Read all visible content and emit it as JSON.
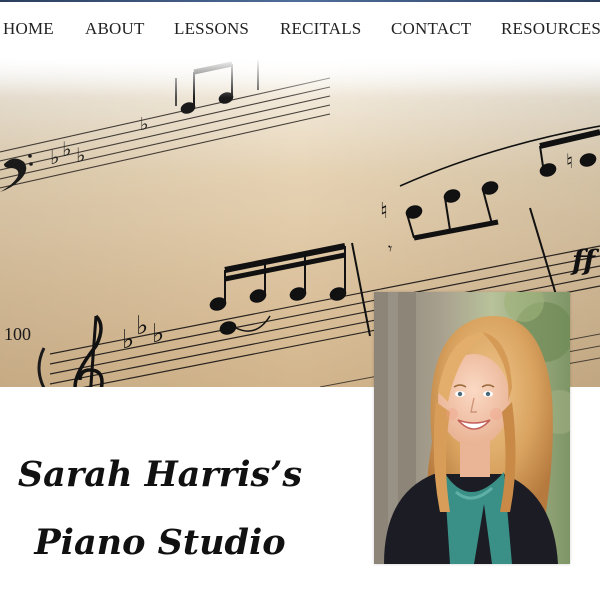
{
  "nav": {
    "items": [
      {
        "id": "home",
        "label": "HOME"
      },
      {
        "id": "about",
        "label": "ABOUT"
      },
      {
        "id": "lessons",
        "label": "LESSONS"
      },
      {
        "id": "recitals",
        "label": "RECITALS"
      },
      {
        "id": "contact",
        "label": "CONTACT"
      },
      {
        "id": "resources",
        "label": "RESOURCES"
      }
    ],
    "accent_color": "#3a5275"
  },
  "hero": {
    "measure_number": "100",
    "dynamic_mark": "ff"
  },
  "title": {
    "line1": "Sarah Harris’s",
    "line2": "Piano Studio"
  },
  "colors": {
    "paper": "#dcc29d",
    "ink": "#1a1a1a",
    "background": "#ffffff"
  }
}
